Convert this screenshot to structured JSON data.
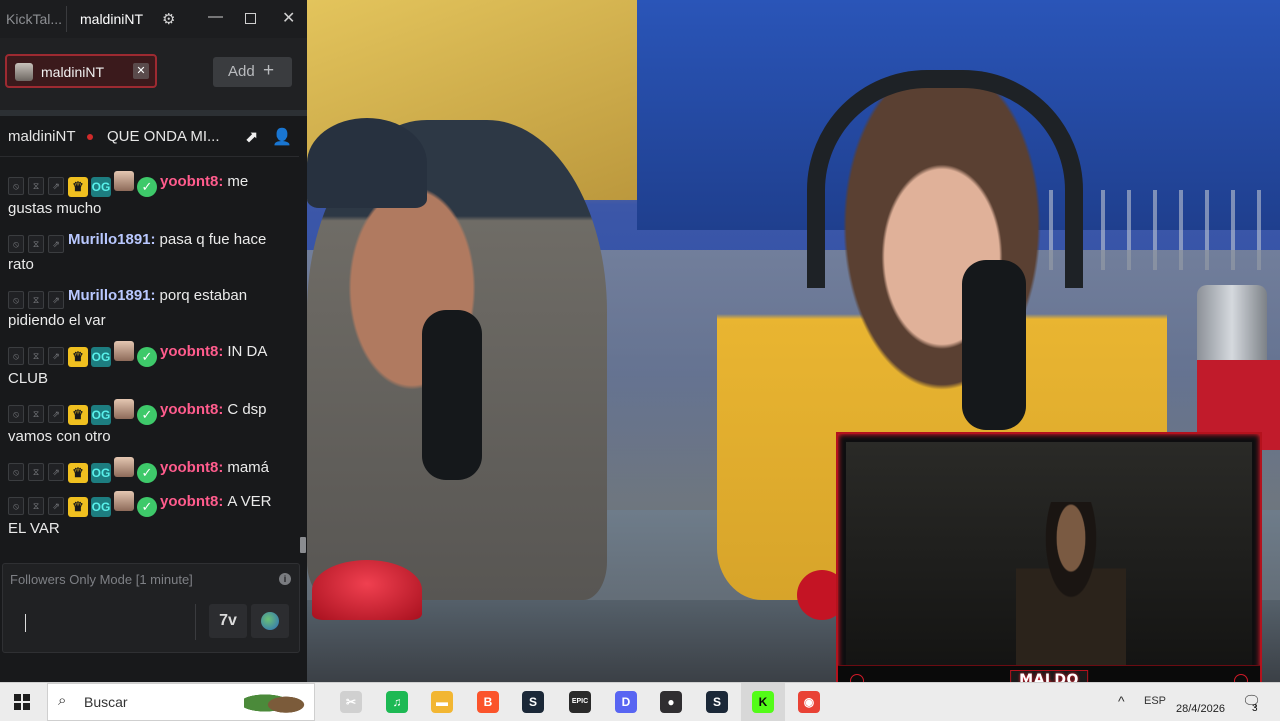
{
  "window": {
    "app_title": "KickTal...",
    "tab_title": "maldiniNT",
    "settings_icon": "gear-icon",
    "minimize_glyph": "—",
    "close_glyph": "✕"
  },
  "channel_bar": {
    "chip_label": "maldiniNT",
    "chip_close": "✕",
    "add_label": "Add",
    "add_plus": "+"
  },
  "stream_info": {
    "username": "maldiniNT",
    "title": "QUE ONDA MI...",
    "live_color": "#d02a2a"
  },
  "messages": [
    {
      "user": "yoobnt8:",
      "color": "#ff5c8d",
      "text": "me gustas mucho",
      "badges": [
        "crown",
        "og",
        "sub",
        "verified"
      ]
    },
    {
      "user": "Murillo1891:",
      "color": "#b9c8ff",
      "text": "pasa q fue hace rato",
      "badges": []
    },
    {
      "user": "Murillo1891:",
      "color": "#b9c8ff",
      "text": "porq estaban pidiendo el var",
      "badges": []
    },
    {
      "user": "yoobnt8:",
      "color": "#ff5c8d",
      "text": "IN DA CLUB",
      "badges": [
        "crown",
        "og",
        "sub",
        "verified"
      ]
    },
    {
      "user": "yoobnt8:",
      "color": "#ff5c8d",
      "text": "C dsp vamos con otro",
      "badges": [
        "crown",
        "og",
        "sub",
        "verified"
      ]
    },
    {
      "user": "yoobnt8:",
      "color": "#ff5c8d",
      "text": "mamá",
      "badges": [
        "crown",
        "og",
        "sub",
        "verified"
      ]
    },
    {
      "user": "yoobnt8:",
      "color": "#ff5c8d",
      "text": "A VER EL VAR",
      "badges": [
        "crown",
        "og",
        "sub",
        "verified"
      ]
    }
  ],
  "badge_glyphs": {
    "crown": "♛",
    "og": "OG",
    "verified": "✓",
    "sub": ""
  },
  "input": {
    "followers_mode": "Followers Only Mode [1 minute]",
    "info": "i",
    "emote_button": "7v"
  },
  "webcam": {
    "streamer_name": "MALDO",
    "accent_color": "#b4121d"
  },
  "taskbar": {
    "search_placeholder": "Buscar",
    "apps": [
      {
        "name": "snipping-tool",
        "glyph": "✂",
        "color": "#d0d0d0"
      },
      {
        "name": "spotify",
        "glyph": "♫",
        "color": "#1db954"
      },
      {
        "name": "file-explorer",
        "glyph": "▬",
        "color": "#f2b632"
      },
      {
        "name": "brave",
        "glyph": "B",
        "color": "#fb542b"
      },
      {
        "name": "steam",
        "glyph": "S",
        "color": "#1b2838"
      },
      {
        "name": "epic-games",
        "glyph": "EPIC",
        "color": "#2a2a2a"
      },
      {
        "name": "discord",
        "glyph": "D",
        "color": "#5865f2"
      },
      {
        "name": "obs",
        "glyph": "●",
        "color": "#302e31"
      },
      {
        "name": "steam-2",
        "glyph": "S",
        "color": "#1b2838"
      },
      {
        "name": "kick",
        "glyph": "K",
        "color": "#53fc18"
      },
      {
        "name": "chrome",
        "glyph": "◉",
        "color": "#e94235"
      }
    ],
    "tray_chevron": "^",
    "language": "ESP",
    "date": "28/4/2026",
    "notifications": "3"
  }
}
